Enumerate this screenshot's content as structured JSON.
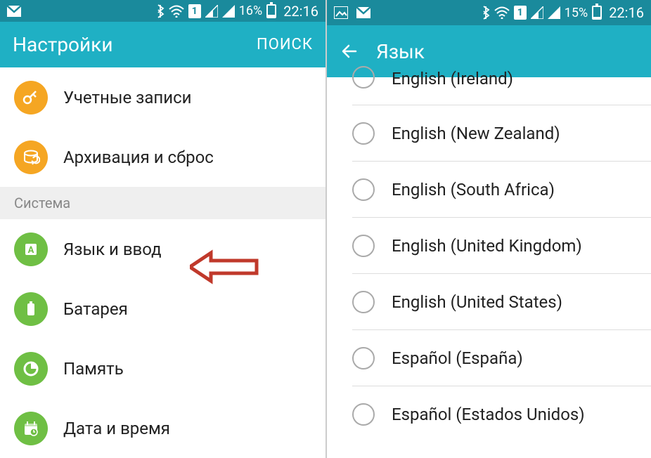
{
  "left": {
    "statusbar": {
      "battery_pct": "16%",
      "time": "22:16",
      "sim": "1"
    },
    "appbar": {
      "title": "Настройки",
      "search": "ПОИСК"
    },
    "items": [
      {
        "label": "Учетные записи",
        "color": "orange",
        "icon": "key"
      },
      {
        "label": "Архивация и сброс",
        "color": "orange",
        "icon": "backup"
      }
    ],
    "section": "Система",
    "items2": [
      {
        "label": "Язык и ввод",
        "color": "green",
        "icon": "lang"
      },
      {
        "label": "Батарея",
        "color": "green",
        "icon": "batt"
      },
      {
        "label": "Память",
        "color": "green",
        "icon": "mem"
      },
      {
        "label": "Дата и время",
        "color": "green",
        "icon": "date"
      }
    ]
  },
  "right": {
    "statusbar": {
      "battery_pct": "15%",
      "time": "22:16",
      "sim": "1"
    },
    "appbar": {
      "title": "Язык"
    },
    "options": [
      "English (Ireland)",
      "English (New Zealand)",
      "English (South Africa)",
      "English (United Kingdom)",
      "English (United States)",
      "Español (España)",
      "Español (Estados Unidos)"
    ]
  }
}
